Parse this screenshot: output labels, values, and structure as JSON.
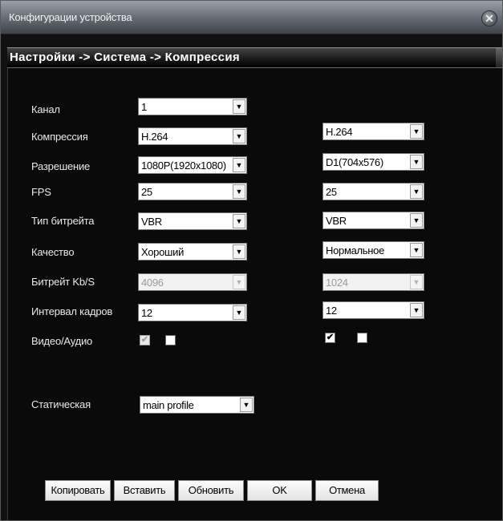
{
  "window": {
    "title": "Конфигурации устройства",
    "close_glyph": "✕"
  },
  "breadcrumb": "Настройки -> Система -> Компрессия",
  "labels": {
    "channel": "Канал",
    "compression": "Компрессия",
    "resolution": "Разрешение",
    "fps": "FPS",
    "bitrate_type": "Тип битрейта",
    "quality": "Качество",
    "bitrate": "Битрейт Kb/S",
    "frame_interval": "Интервал кадров",
    "video_audio": "Видео/Аудио",
    "static": "Статическая"
  },
  "main_stream": {
    "channel": "1",
    "compression": "H.264",
    "resolution": "1080P(1920x1080)",
    "fps": "25",
    "bitrate_type": "VBR",
    "quality": "Хороший",
    "bitrate": "4096",
    "frame_interval": "12",
    "video_checked": true,
    "audio_checked": false
  },
  "extra_stream": {
    "compression": "H.264",
    "resolution": "D1(704x576)",
    "fps": "25",
    "bitrate_type": "VBR",
    "quality": "Нормальное",
    "bitrate": "1024",
    "frame_interval": "12",
    "video_checked": true,
    "audio_checked": false
  },
  "profile": "main profile",
  "checkmark_glyph": "✔",
  "dropdown_glyph": "▼",
  "buttons": {
    "copy": "Копировать",
    "paste": "Вставить",
    "refresh": "Обновить",
    "ok": "OK",
    "cancel": "Отмена"
  }
}
